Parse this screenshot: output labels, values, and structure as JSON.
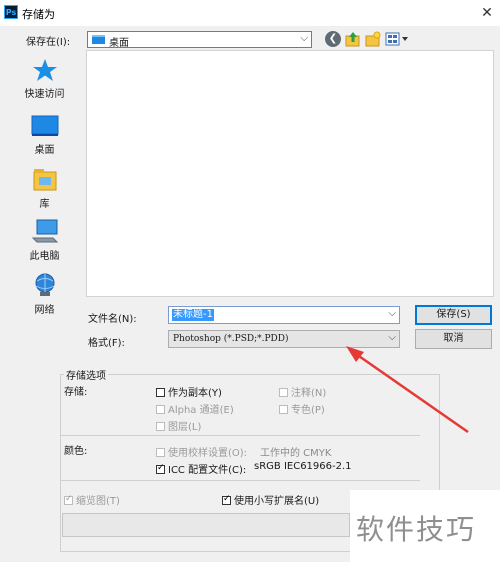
{
  "window": {
    "title": "存储为",
    "app_icon_text": "Ps",
    "close_glyph": "✕"
  },
  "save_in": {
    "label": "保存在(I):",
    "value": "桌面",
    "arrow": "⌵"
  },
  "toolbar": {
    "back_glyph": "❮"
  },
  "places": [
    {
      "label": "快速访问",
      "icon": "star-icon"
    },
    {
      "label": "桌面",
      "icon": "desktop-icon"
    },
    {
      "label": "库",
      "icon": "library-icon"
    },
    {
      "label": "此电脑",
      "icon": "computer-icon"
    },
    {
      "label": "网络",
      "icon": "network-icon"
    }
  ],
  "file_name": {
    "label": "文件名(N):",
    "value": "未标题-1",
    "arrow": "⌵"
  },
  "format": {
    "label": "格式(F):",
    "value": "Photoshop (*.PSD;*.PDD)",
    "arrow": "⌵"
  },
  "buttons": {
    "save": "保存(S)",
    "cancel": "取消"
  },
  "options": {
    "group_title": "存储选项",
    "save_label": "存储:",
    "as_copy": "作为副本(Y)",
    "notes": "注释(N)",
    "alpha": "Alpha 通道(E)",
    "spot": "专色(P)",
    "layers": "图层(L)",
    "color_label": "颜色:",
    "use_proof": "使用校样设置(O):",
    "proof_value": "工作中的 CMYK",
    "icc": "ICC 配置文件(C):",
    "icc_value": "sRGB IEC61966-2.1",
    "thumbnail": "缩览图(T)",
    "lowercase_ext": "使用小写扩展名(U)",
    "tick_glyph": "✓"
  },
  "watermark": "软件技巧",
  "colors": {
    "accent": "#0078d7",
    "selection": "#3399ff",
    "annotation_arrow": "#e53935"
  }
}
